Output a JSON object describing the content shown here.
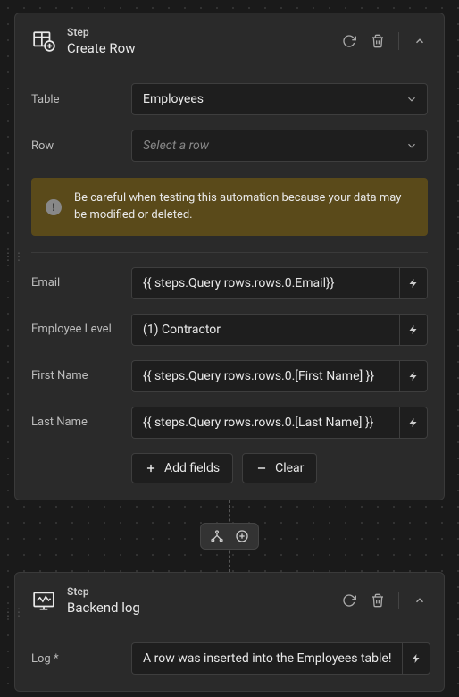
{
  "steps": [
    {
      "label": "Step",
      "name": "Create Row",
      "fields": {
        "table": {
          "label": "Table",
          "value": "Employees"
        },
        "row": {
          "label": "Row",
          "placeholder": "Select a row"
        },
        "email": {
          "label": "Email",
          "value": "{{ steps.Query rows.rows.0.Email}}"
        },
        "employee_level": {
          "label": "Employee Level",
          "value": "(1) Contractor"
        },
        "first_name": {
          "label": "First Name",
          "value": "{{ steps.Query rows.rows.0.[First Name] }}"
        },
        "last_name": {
          "label": "Last Name",
          "value": "{{ steps.Query rows.rows.0.[Last Name] }}"
        }
      },
      "warning": "Be careful when testing this automation because your data may be modified or deleted.",
      "buttons": {
        "add_fields": "Add fields",
        "clear": "Clear"
      }
    },
    {
      "label": "Step",
      "name": "Backend log",
      "fields": {
        "log": {
          "label": "Log *",
          "value": "A row was inserted into the Employees table!"
        }
      }
    }
  ]
}
